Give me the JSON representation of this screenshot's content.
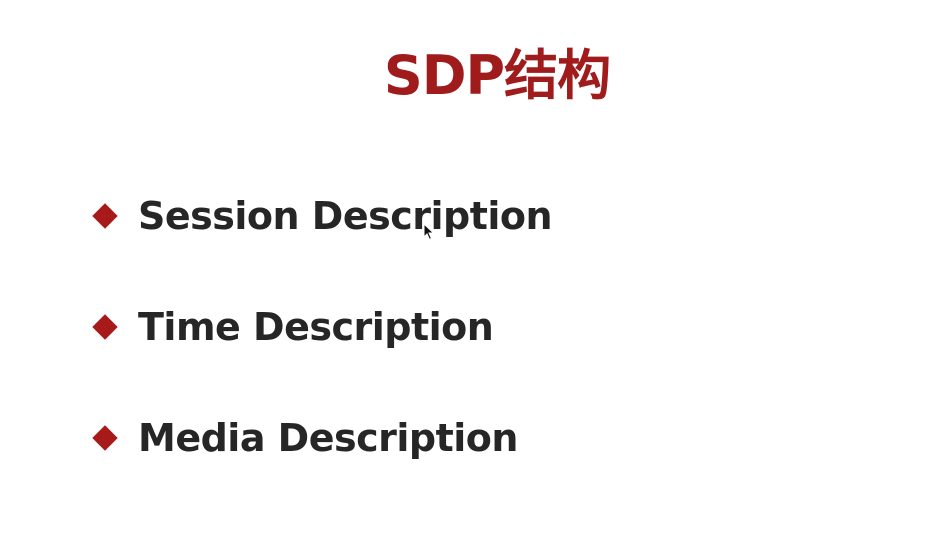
{
  "slide": {
    "title": "SDP结构",
    "bullets": [
      {
        "icon": "diamond-bullet-icon",
        "label": "Session Description"
      },
      {
        "icon": "diamond-bullet-icon",
        "label": "Time Description"
      },
      {
        "icon": "diamond-bullet-icon",
        "label": "Media Description"
      }
    ]
  },
  "colors": {
    "title": "#a01c1c",
    "bullet": "#a81a1a",
    "text": "#262626",
    "background": "#ffffff"
  }
}
